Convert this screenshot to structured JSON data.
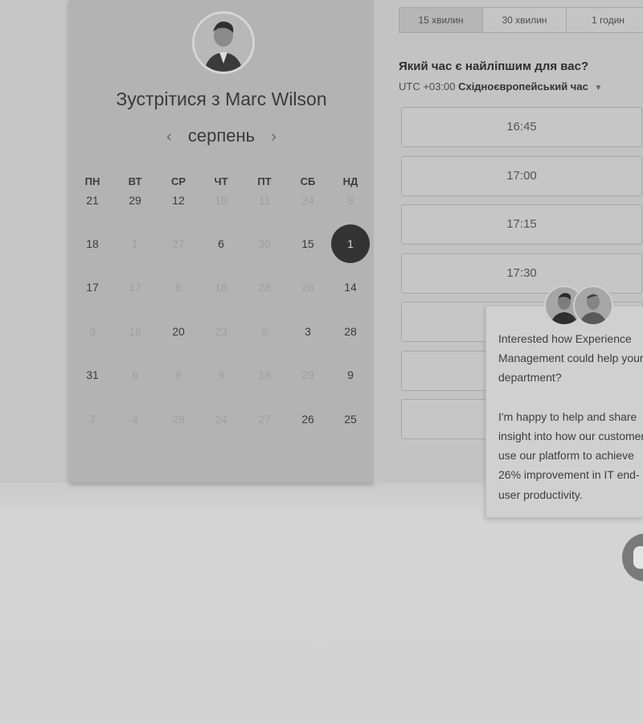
{
  "booking": {
    "title": "Зустрітися з Marc Wilson",
    "month": "серпень",
    "nav_prev": "‹",
    "nav_next": "›",
    "weekdays": [
      "ПН",
      "ВТ",
      "СР",
      "ЧТ",
      "ПТ",
      "СБ",
      "НД"
    ],
    "days": [
      [
        "21",
        "29",
        "12",
        "18",
        "11",
        "24",
        "8"
      ],
      [
        "18",
        "1",
        "27",
        "6",
        "30",
        "15",
        "1"
      ],
      [
        "17",
        "17",
        "8",
        "18",
        "28",
        "26",
        "14"
      ],
      [
        "3",
        "16",
        "20",
        "23",
        "5",
        "3",
        "28"
      ],
      [
        "31",
        "6",
        "9",
        "9",
        "18",
        "29",
        "9"
      ],
      [
        "7",
        "4",
        "29",
        "24",
        "27",
        "26",
        "25"
      ]
    ],
    "dim": [
      [
        0,
        0,
        0,
        1,
        1,
        1,
        1
      ],
      [
        0,
        1,
        1,
        0,
        1,
        0,
        0
      ],
      [
        0,
        1,
        1,
        1,
        1,
        1,
        0
      ],
      [
        1,
        1,
        0,
        1,
        1,
        0,
        0
      ],
      [
        0,
        1,
        1,
        1,
        1,
        1,
        0
      ],
      [
        1,
        1,
        1,
        1,
        1,
        0,
        0
      ]
    ],
    "selected_day": "1"
  },
  "schedule": {
    "durations": [
      "15 хвилин",
      "30 хвилин",
      "1 годин"
    ],
    "question": "Який час є найліпшим для вас?",
    "tz_offset": "UTC +03:00",
    "tz_name": "Східноєвропейський час",
    "slots": [
      "16:45",
      "17:00",
      "17:15",
      "17:30",
      "",
      "",
      "",
      ""
    ]
  },
  "chat": {
    "message": "Interested how Experience Management could help your IT department?\n\nI'm happy to help and share insight into how our customers use our platform to achieve 26% improvement in IT end-user productivity."
  }
}
